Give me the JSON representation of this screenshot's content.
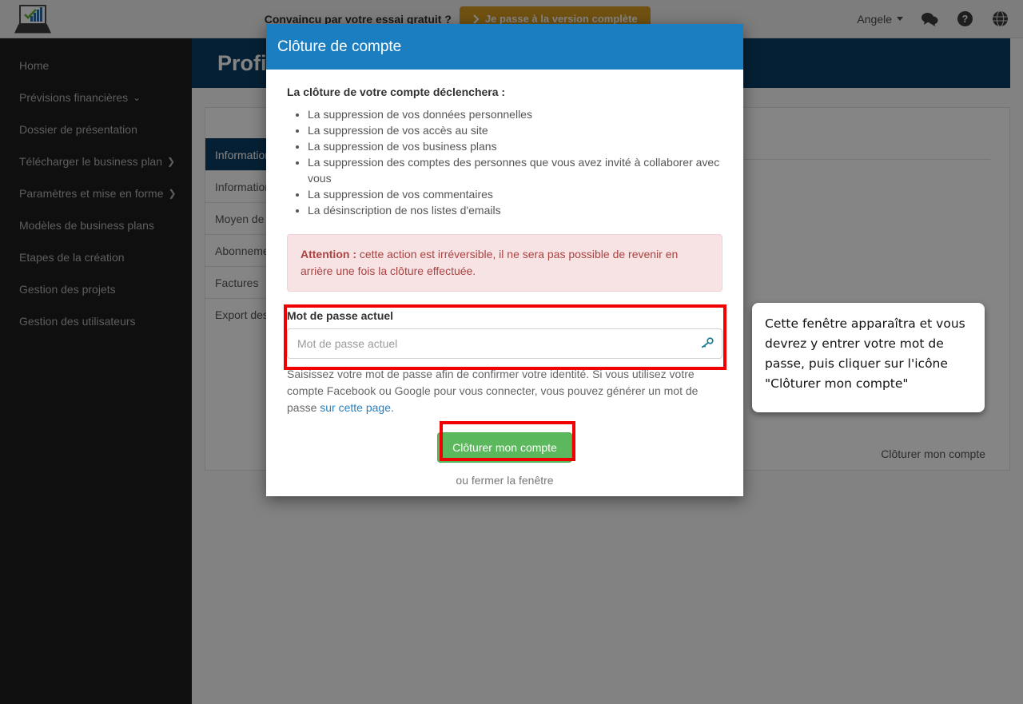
{
  "topbar": {
    "logo_name": "laptop-chart-logo",
    "promo_text": "Convaincu par votre essai gratuit ?",
    "promo_button": "Je passe à la version complète",
    "user_name": "Angele",
    "icons": [
      "chat-icon",
      "help-icon",
      "globe-icon"
    ]
  },
  "sidebar": {
    "items": [
      {
        "label": "Home",
        "chevron": ""
      },
      {
        "label": "Prévisions financières",
        "chevron": "⌄"
      },
      {
        "label": "Dossier de présentation",
        "chevron": ""
      },
      {
        "label": "Télécharger le business plan",
        "chevron": "❯"
      },
      {
        "label": "Paramètres et mise en forme",
        "chevron": "❯"
      },
      {
        "label": "Modèles de business plans",
        "chevron": ""
      },
      {
        "label": "Etapes de la création",
        "chevron": ""
      },
      {
        "label": "Gestion des projets",
        "chevron": ""
      },
      {
        "label": "Gestion des utilisateurs",
        "chevron": ""
      }
    ]
  },
  "page": {
    "title": "Profil",
    "tabs": [
      {
        "label": "Informations personnelles",
        "active": true
      },
      {
        "label": "Informations de facturation",
        "active": false
      },
      {
        "label": "Moyen de paiement",
        "active": false
      },
      {
        "label": "Abonnement",
        "active": false
      },
      {
        "label": "Factures",
        "active": false
      },
      {
        "label": "Export des données",
        "active": false
      }
    ],
    "panel_link": "Clôturer mon compte"
  },
  "modal": {
    "title": "Clôture de compte",
    "lead": "La clôture de votre compte déclenchera :",
    "consequences": [
      "La suppression de vos données personnelles",
      "La suppression de vos accès au site",
      "La suppression de vos business plans",
      "La suppression des comptes des personnes que vous avez invité à collaborer avec vous",
      "La suppression de vos commentaires",
      "La désinscription de nos listes d'emails"
    ],
    "alert_label": "Attention :",
    "alert_text": " cette action est irréversible, il ne sera pas possible de revenir en arrière une fois la clôture effectuée.",
    "password_label": "Mot de passe actuel",
    "password_placeholder": "Mot de passe actuel",
    "password_value": "",
    "password_icon": "key-icon",
    "help_text_before": "Saisissez votre mot de passe afin de confirmer votre identité. Si vous utilisez votre compte Facebook ou Google pour vous connecter, vous pouvez générer un mot de passe ",
    "help_link": "sur cette page",
    "help_text_after": ".",
    "submit_button": "Clôturer mon compte",
    "close_text": "ou fermer la fenêtre"
  },
  "callout": {
    "text": "Cette fenêtre apparaîtra et vous devrez y entrer votre mot de passe, puis cliquer sur l'icône \"Clôturer mon compte\""
  },
  "colors": {
    "modal_header_blue": "#1a7ec1",
    "page_header_blue": "#0b3f66",
    "submit_green": "#5cb85c",
    "promo_gold": "#d79b21",
    "alert_red": "#a94442",
    "alert_bg": "#f7e2e4",
    "highlight_red": "#f00000",
    "link_blue": "#2a7fbd",
    "key_icon_teal": "#17798e",
    "sidebar_dark": "#1d1d1d"
  }
}
